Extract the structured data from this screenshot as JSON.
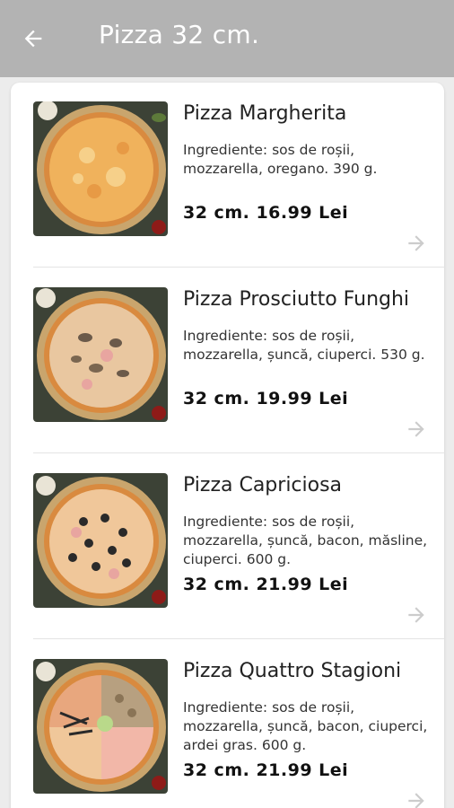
{
  "appbar": {
    "back_icon": "arrow-left-icon",
    "title": "Pizza 32 cm."
  },
  "products": [
    {
      "name": "Pizza Margherita",
      "ingredients": "Ingrediente: sos de roșii, mozzarella, oregano. 390 g.",
      "price": "32 cm. 16.99 Lei",
      "image": "pizza-margherita-image"
    },
    {
      "name": "Pizza Prosciutto Funghi",
      "ingredients": "Ingrediente: sos de roșii, mozzarella, șuncă, ciuperci. 530 g.",
      "price": "32 cm. 19.99 Lei",
      "image": "pizza-prosciutto-funghi-image"
    },
    {
      "name": "Pizza Capriciosa",
      "ingredients": "Ingrediente: sos de roșii, mozzarella, șuncă, bacon, măsline, ciuperci. 600 g.",
      "price": "32 cm. 21.99 Lei",
      "image": "pizza-capriciosa-image"
    },
    {
      "name": "Pizza Quattro Stagioni",
      "ingredients": "Ingrediente: sos de roșii, mozzarella, șuncă, bacon, ciuperci, ardei gras. 600 g.",
      "price": "32 cm. 21.99 Lei",
      "image": "pizza-quattro-stagioni-image"
    }
  ],
  "colors": {
    "appbar": "#b3b3b3",
    "background": "#ececec",
    "card": "#ffffff",
    "arrow": "#cccccc"
  }
}
